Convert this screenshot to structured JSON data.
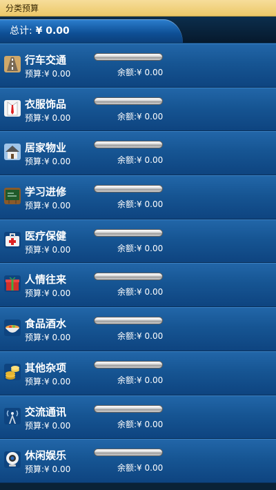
{
  "app": {
    "title": "分类预算"
  },
  "summary": {
    "total_label": "总计:",
    "total_value": "¥ 0.00"
  },
  "categories": [
    {
      "name": "行车交通",
      "icon": "road-icon",
      "budget_label": "预算:",
      "budget": "¥ 0.00",
      "remain_label": "余额:",
      "remain": "¥ 0.00",
      "progress": 0
    },
    {
      "name": "衣服饰品",
      "icon": "shirt-tie-icon",
      "budget_label": "预算:",
      "budget": "¥ 0.00",
      "remain_label": "余额:",
      "remain": "¥ 0.00",
      "progress": 0
    },
    {
      "name": "居家物业",
      "icon": "house-icon",
      "budget_label": "预算:",
      "budget": "¥ 0.00",
      "remain_label": "余额:",
      "remain": "¥ 0.00",
      "progress": 0
    },
    {
      "name": "学习进修",
      "icon": "chalkboard-icon",
      "budget_label": "预算:",
      "budget": "¥ 0.00",
      "remain_label": "余额:",
      "remain": "¥ 0.00",
      "progress": 0
    },
    {
      "name": "医疗保健",
      "icon": "first-aid-kit-icon",
      "budget_label": "预算:",
      "budget": "¥ 0.00",
      "remain_label": "余额:",
      "remain": "¥ 0.00",
      "progress": 0
    },
    {
      "name": "人情往来",
      "icon": "gift-icon",
      "budget_label": "预算:",
      "budget": "¥ 0.00",
      "remain_label": "余额:",
      "remain": "¥ 0.00",
      "progress": 0
    },
    {
      "name": "食品酒水",
      "icon": "food-bowl-icon",
      "budget_label": "预算:",
      "budget": "¥ 0.00",
      "remain_label": "余额:",
      "remain": "¥ 0.00",
      "progress": 0
    },
    {
      "name": "其他杂项",
      "icon": "coins-icon",
      "budget_label": "预算:",
      "budget": "¥ 0.00",
      "remain_label": "余额:",
      "remain": "¥ 0.00",
      "progress": 0
    },
    {
      "name": "交流通讯",
      "icon": "signal-tower-icon",
      "budget_label": "预算:",
      "budget": "¥ 0.00",
      "remain_label": "余额:",
      "remain": "¥ 0.00",
      "progress": 0
    },
    {
      "name": "休闲娱乐",
      "icon": "webcam-icon",
      "budget_label": "预算:",
      "budget": "¥ 0.00",
      "remain_label": "余额:",
      "remain": "¥ 0.00",
      "progress": 0
    }
  ]
}
